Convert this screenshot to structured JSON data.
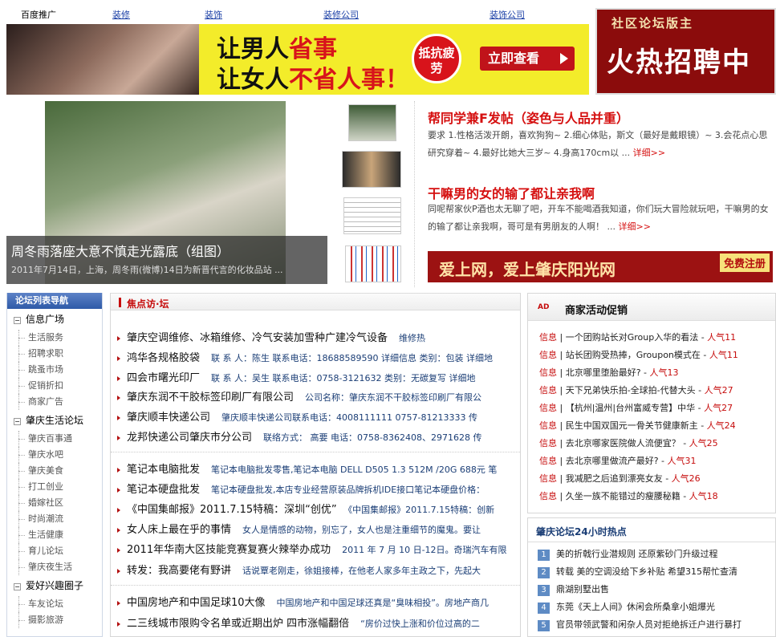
{
  "topbar": {
    "label": "百度推广",
    "links": [
      "装修",
      "装饰",
      "装修公司",
      "装饰公司"
    ]
  },
  "ad": {
    "line1_a": "让男人",
    "line1_b": "省事",
    "line2_a": "让女人",
    "line2_b": "不省人事！",
    "seal": "抵抗疲劳",
    "button": "立即查看"
  },
  "recruit": {
    "top": "社区论坛版主",
    "big": "火热招聘中"
  },
  "feature": {
    "title": "周冬雨落座大意不慎走光露底（组图）",
    "subtitle": "2011年7月14日，上海，周冬雨(微博)14日为新晋代言的化妆品站 ..."
  },
  "news": [
    {
      "title": "帮同学兼F发帖（姿色与人品并重）",
      "body": "要求 1.性格活泼开朗，喜欢狗狗~ 2.细心体贴，斯文（最好是戴眼镜）~ 3.会花点心思研究穿着~ 4.最好比她大三岁~ 4.身高170cm以 ...",
      "more": "详细>>"
    },
    {
      "title": "干嘛男的女的输了都让亲我啊",
      "body": "同呢帮家伙P酒也太无聊了吧，开车不能喝酒我知道，你们玩大冒险就玩吧，干嘛男的女的输了都让亲我啊，哥可是有男朋友的人啊！ ...",
      "more": "详细>>"
    }
  ],
  "register_banner": {
    "text": "爱上网，爱上肇庆阳光网",
    "button": "免费注册"
  },
  "sidebar": {
    "header": "论坛列表导航",
    "groups": [
      {
        "name": "信息广场",
        "items": [
          "生活服务",
          "招聘求职",
          "跳蚤市场",
          "促销折扣",
          "商家广告"
        ]
      },
      {
        "name": "肇庆生活论坛",
        "items": [
          "肇庆百事通",
          "肇庆水吧",
          "肇庆美食",
          "打工创业",
          "婚嫁社区",
          "时尚潮流",
          "生活健康",
          "育儿论坛",
          "肇庆夜生活"
        ]
      },
      {
        "name": "爱好兴趣圈子",
        "items": [
          "车友论坛",
          "摄影旅游"
        ]
      }
    ]
  },
  "focus": {
    "title": "焦点访·坛",
    "rows": [
      {
        "t": "肇庆空调维修、冰箱维修、冷气安装加雪种广建冷气设备",
        "d": "维修热"
      },
      {
        "t": "鸿华各规格胶袋",
        "d": "联 系 人：陈生 联系电话：18688589590 详细信息 类别：包装 详细地"
      },
      {
        "t": "四会市曙光印厂",
        "d": "联 系 人：吴生 联系电话：0758-3121632 类别：无碳复写 详细地"
      },
      {
        "t": "肇庆东润不干胶标签印刷厂有限公司",
        "d": "公司名称：肇庆东润不干胶标签印刷厂有限公"
      },
      {
        "t": "肇庆顺丰快递公司",
        "d": "肇庆顺丰快递公司联系电话：4008111111 0757-81213333 传"
      },
      {
        "t": "龙邦快递公司肇庆市分公司",
        "d": "联络方式： 高要 电话：0758-8362408、2971628 传"
      },
      {
        "t": "笔记本电脑批发",
        "d": "笔记本电脑批发零售,笔记本电脑 DELL D505 1.3 512M /20G 688元 笔"
      },
      {
        "t": "笔记本硬盘批发",
        "d": "笔记本硬盘批发,本店专业经营原装品牌拆机IDE接口笔记本硬盘价格："
      },
      {
        "t": "《中国集邮报》2011.7.15特稿：深圳“创优”",
        "d": "《中国集邮报》2011.7.15特稿：创新"
      },
      {
        "t": "女人床上最在乎的事情",
        "d": "女人是情感的动物，别忘了，女人也是注重细节的魔鬼。要让"
      },
      {
        "t": "2011年华南大区技能竞赛复赛火辣举办成功",
        "d": "2011 年 7 月 10 日-12日。奇瑞汽车有限"
      },
      {
        "t": "转发：我高要佬有野讲",
        "d": "话说覃老刚走，徐姐接棒，在他老人家多年主政之下，先起大"
      },
      {
        "t": "中国房地产和中国足球10大像",
        "d": "中国房地产和中国足球还真是“臭味相投”。房地产商几"
      },
      {
        "t": "二三线城市限购令名单或近期出炉 四市涨幅翻倍",
        "d": "“房价过快上涨和价位过高的二"
      }
    ]
  },
  "promo": {
    "icon": "AD",
    "title": "商家活动促销",
    "tag": "信息",
    "pop_label": "人气",
    "items": [
      {
        "t": "一个团购站长对Group入华的看法 -",
        "n": "11"
      },
      {
        "t": "站长团购受热捧，Groupon模式在 -",
        "n": "11"
      },
      {
        "t": "北京哪里堕胎最好? -",
        "n": "13"
      },
      {
        "t": "天下兄弟快乐拍-全球拍-代替大头 -",
        "n": "27"
      },
      {
        "t": "【杭州|温州|台州富威专营】中华 -",
        "n": "27"
      },
      {
        "t": "民生中国双国元一骨关节健康新主 -",
        "n": "24"
      },
      {
        "t": "去北京哪家医院做人流便宜？ -",
        "n": "25"
      },
      {
        "t": "去北京哪里做流产最好? -",
        "n": "31"
      },
      {
        "t": "我减肥之后追到漂亮女友 -",
        "n": "26"
      },
      {
        "t": "久坐一族不能错过的瘦腰秘籍 -",
        "n": "18"
      }
    ]
  },
  "hot": {
    "title": "肇庆论坛24小时热点",
    "items": [
      {
        "n": "1",
        "t": "美的折戟行业潜规则 还原紫砂门升级过程"
      },
      {
        "n": "2",
        "t": "转载 美的空调没给下乡补贴 希望315帮忙查清"
      },
      {
        "n": "3",
        "t": "鼎湖别墅出售"
      },
      {
        "n": "4",
        "t": "东莞《天上人间》休闲会所桑拿小姐爆光"
      },
      {
        "n": "5",
        "t": "官员带领武警和闲杂人员对拒绝拆迁户进行暴打"
      }
    ]
  }
}
